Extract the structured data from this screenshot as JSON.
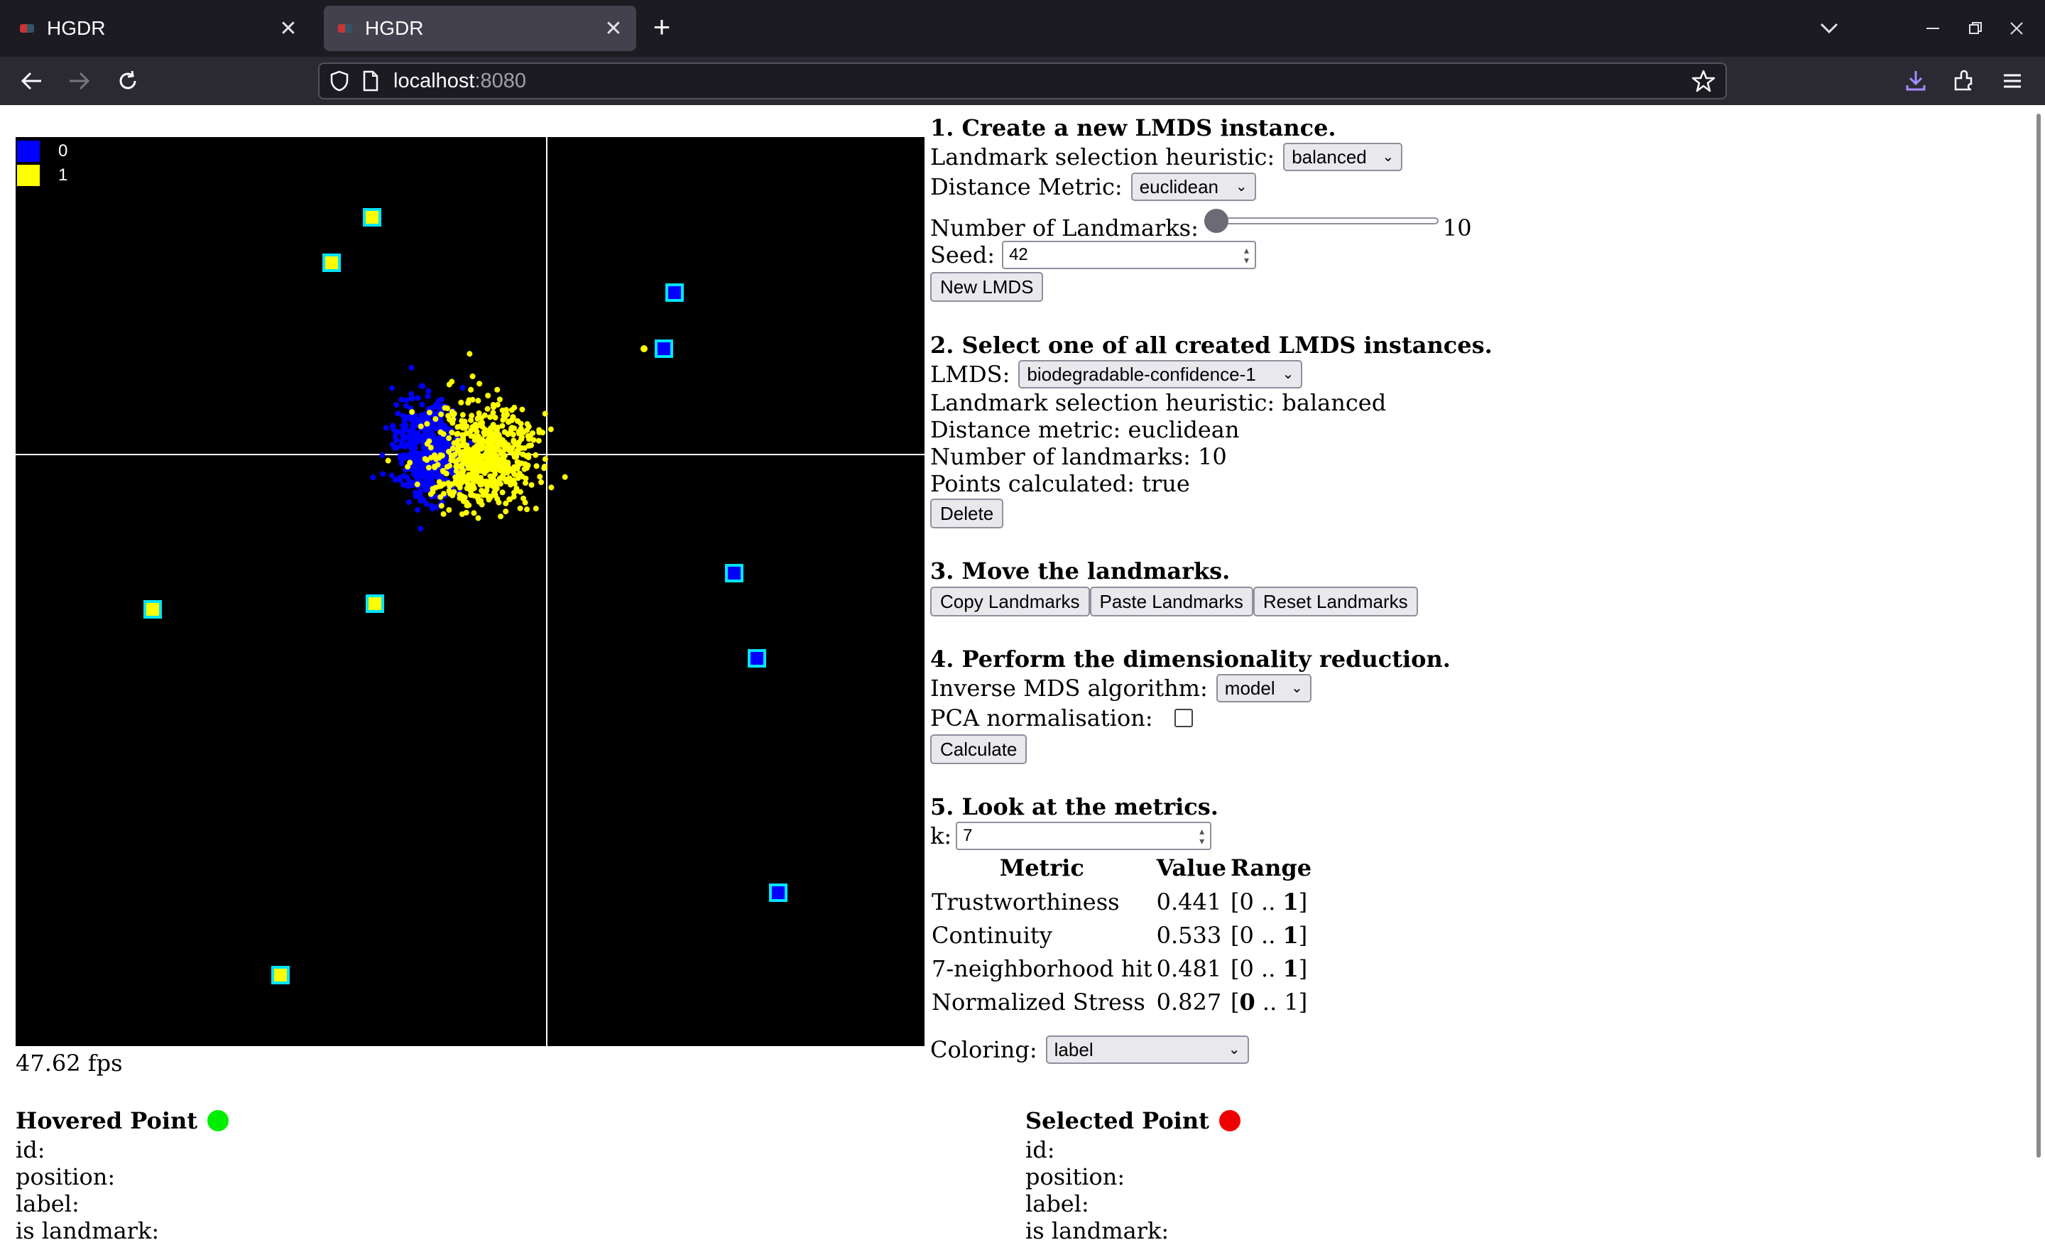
{
  "browser": {
    "tabs": [
      {
        "title": "HGDR",
        "active": false
      },
      {
        "title": "HGDR",
        "active": true
      }
    ],
    "url_host": "localhost",
    "url_port": ":8080"
  },
  "legend": [
    {
      "label": "0",
      "color": "#0000ff"
    },
    {
      "label": "1",
      "color": "#ffff00"
    }
  ],
  "fps": "47.62 fps",
  "section1": {
    "title": "1. Create a new LMDS instance.",
    "heuristic_label": "Landmark selection heuristic:",
    "heuristic_value": "balanced",
    "metric_label": "Distance Metric:",
    "metric_value": "euclidean",
    "landmarks_label": "Number of Landmarks:",
    "landmarks_value": "10",
    "seed_label": "Seed:",
    "seed_value": "42",
    "new_button": "New LMDS"
  },
  "section2": {
    "title": "2. Select one of all created LMDS instances.",
    "lmds_label": "LMDS:",
    "lmds_value": "biodegradable-confidence-1",
    "info_heuristic": "Landmark selection heuristic: balanced",
    "info_metric": "Distance metric: euclidean",
    "info_landmarks": "Number of landmarks: 10",
    "info_points": "Points calculated: true",
    "delete_button": "Delete"
  },
  "section3": {
    "title": "3. Move the landmarks.",
    "copy_button": "Copy Landmarks",
    "paste_button": "Paste Landmarks",
    "reset_button": "Reset Landmarks"
  },
  "section4": {
    "title": "4. Perform the dimensionality reduction.",
    "algo_label": "Inverse MDS algorithm:",
    "algo_value": "model",
    "pca_label": "PCA normalisation:",
    "pca_checked": false,
    "calc_button": "Calculate"
  },
  "section5": {
    "title": "5. Look at the metrics.",
    "k_label": "k:",
    "k_value": "7",
    "headers": [
      "Metric",
      "Value",
      "Range"
    ],
    "rows": [
      {
        "metric": "Trustworthiness",
        "value": "0.441",
        "range_open": "[0 .. ",
        "range_bold": "1",
        "range_close": "]",
        "bold_low": false
      },
      {
        "metric": "Continuity",
        "value": "0.533",
        "range_open": "[0 .. ",
        "range_bold": "1",
        "range_close": "]",
        "bold_low": false
      },
      {
        "metric": "7-neighborhood hit",
        "value": "0.481",
        "range_open": "[0 .. ",
        "range_bold": "1",
        "range_close": "]",
        "bold_low": false
      },
      {
        "metric": "Normalized Stress",
        "value": "0.827",
        "range_open": "[",
        "range_bold": "0",
        "range_close": " .. 1]",
        "bold_low": true
      }
    ],
    "coloring_label": "Coloring:",
    "coloring_value": "label"
  },
  "hovered": {
    "title": "Hovered Point",
    "color": "#00ee00",
    "fields": [
      "id:",
      "position:",
      "label:",
      "is landmark:"
    ]
  },
  "selected": {
    "title": "Selected Point",
    "color": "#ee0000",
    "fields": [
      "id:",
      "position:",
      "label:",
      "is landmark:"
    ]
  }
}
